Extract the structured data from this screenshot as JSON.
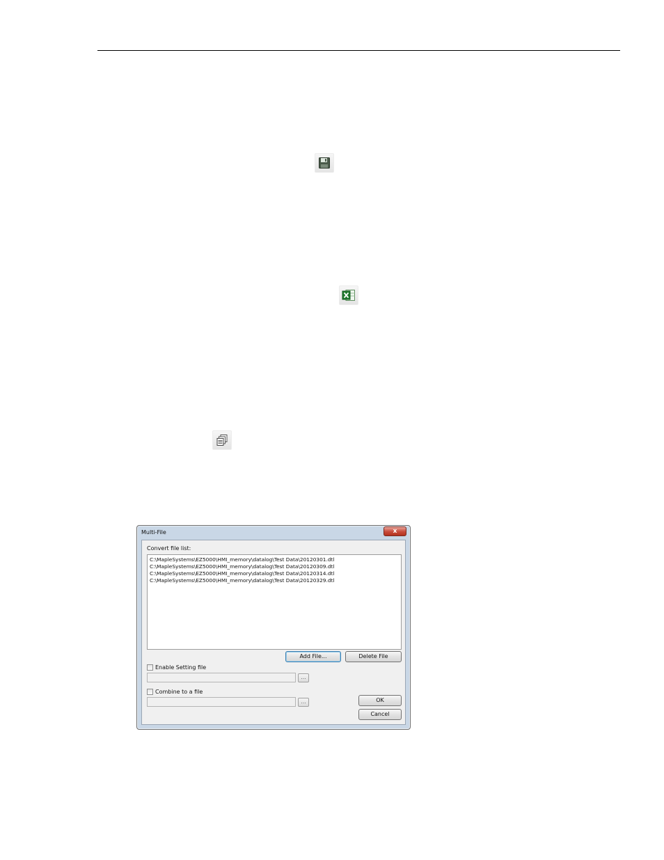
{
  "toolbar_icons": {
    "save": "save-icon",
    "excel": "excel-export-icon",
    "multi_file": "multi-file-icon"
  },
  "dialog": {
    "title": "Multi-File",
    "close_glyph": "x",
    "convert_list_label": "Convert file list:",
    "files": [
      "C:\\MapleSystems\\EZ5000\\HMI_memory\\datalog\\Test Data\\20120301.dtl",
      "C:\\MapleSystems\\EZ5000\\HMI_memory\\datalog\\Test Data\\20120309.dtl",
      "C:\\MapleSystems\\EZ5000\\HMI_memory\\datalog\\Test Data\\20120314.dtl",
      "C:\\MapleSystems\\EZ5000\\HMI_memory\\datalog\\Test Data\\20120329.dtl"
    ],
    "add_file_label": "Add File...",
    "delete_file_label": "Delete File",
    "enable_setting_label": "Enable Setting file",
    "enable_setting_checked": false,
    "setting_path_value": "",
    "browse_label": "...",
    "combine_label": "Combine to a file",
    "combine_checked": false,
    "combine_path_value": "",
    "ok_label": "OK",
    "cancel_label": "Cancel"
  }
}
